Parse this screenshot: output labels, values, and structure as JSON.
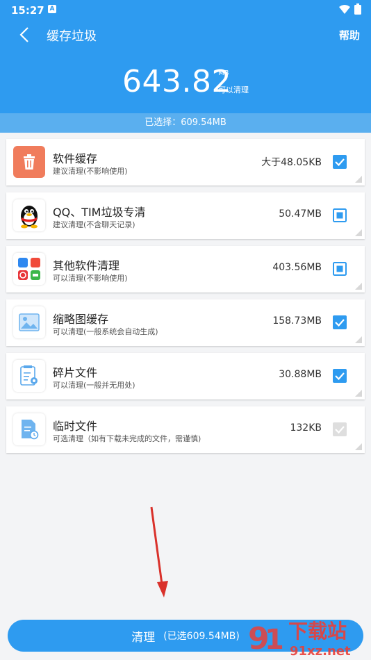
{
  "status_bar": {
    "time": "15:27",
    "notif": "A"
  },
  "header": {
    "title": "缓存垃圾",
    "help": "帮助",
    "total_size": "643.82",
    "unit": "MB",
    "cleanable_label": "可以清理",
    "selected_text": "已选择：609.54MB"
  },
  "items": [
    {
      "name": "软件缓存",
      "desc": "建议清理(不影响使用)",
      "size": "大于48.05KB",
      "state": "checked",
      "icon": "trash-icon"
    },
    {
      "name": "QQ、TIM垃圾专清",
      "desc": "建议清理(不含聊天记录)",
      "size": "50.47MB",
      "state": "partial",
      "icon": "qq-penguin-icon"
    },
    {
      "name": "其他软件清理",
      "desc": "可以清理(不影响使用)",
      "size": "403.56MB",
      "state": "partial",
      "icon": "apps-grid-icon"
    },
    {
      "name": "缩略图缓存",
      "desc": "可以清理(一般系统会自动生成)",
      "size": "158.73MB",
      "state": "checked",
      "icon": "image-icon"
    },
    {
      "name": "碎片文件",
      "desc": "可以清理(一般并无用处)",
      "size": "30.88MB",
      "state": "checked",
      "icon": "document-gear-icon"
    },
    {
      "name": "临时文件",
      "desc": "可选清理（如有下载未完成的文件，需谨慎)",
      "size": "132KB",
      "state": "disabled",
      "icon": "document-clock-icon"
    }
  ],
  "clean_button": {
    "label": "清理",
    "sub": "(已选609.54MB)"
  },
  "watermark": {
    "text": "下载站",
    "url": "91xz.net"
  },
  "colors": {
    "primary": "#2e9bf0",
    "orange": "#f07c5c",
    "red_arrow": "#d9312b"
  }
}
